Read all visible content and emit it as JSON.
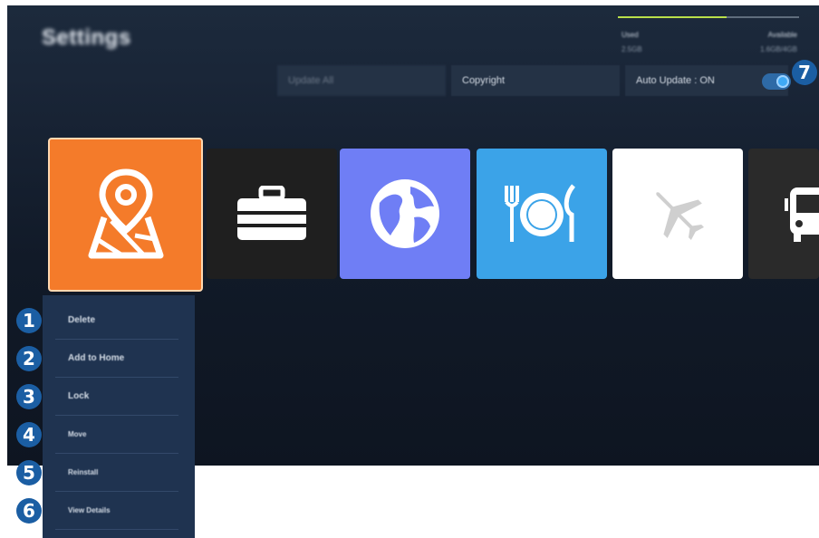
{
  "page_title": "Settings",
  "storage": {
    "used_label": "Used",
    "used_value": "2.5GB",
    "available_label": "Available",
    "available_value": "1.6GB/4GB",
    "used_fraction": 0.6
  },
  "top_bar": {
    "update_all": "Update All",
    "copyright": "Copyright",
    "auto_update": "Auto Update : ON",
    "auto_update_on": true
  },
  "apps": [
    {
      "name": "map",
      "icon": "map-pin-icon",
      "color": "#f47b2a",
      "selected": true
    },
    {
      "name": "briefcase",
      "icon": "briefcase-icon",
      "color": "#1f1f1f"
    },
    {
      "name": "globe",
      "icon": "globe-icon",
      "color": "#6f7ef5"
    },
    {
      "name": "dining",
      "icon": "plate-cutlery-icon",
      "color": "#3ba3e8"
    },
    {
      "name": "airplane",
      "icon": "airplane-icon",
      "color": "#ffffff"
    },
    {
      "name": "bus",
      "icon": "bus-icon",
      "color": "#2a2a2a"
    }
  ],
  "context_menu": [
    "Delete",
    "Add to Home",
    "Lock",
    "Move",
    "Reinstall",
    "View Details"
  ],
  "callouts": [
    "1",
    "2",
    "3",
    "4",
    "5",
    "6",
    "7"
  ],
  "colors": {
    "accent_blue": "#1b5ea3",
    "selection_orange": "#f47b2a"
  }
}
